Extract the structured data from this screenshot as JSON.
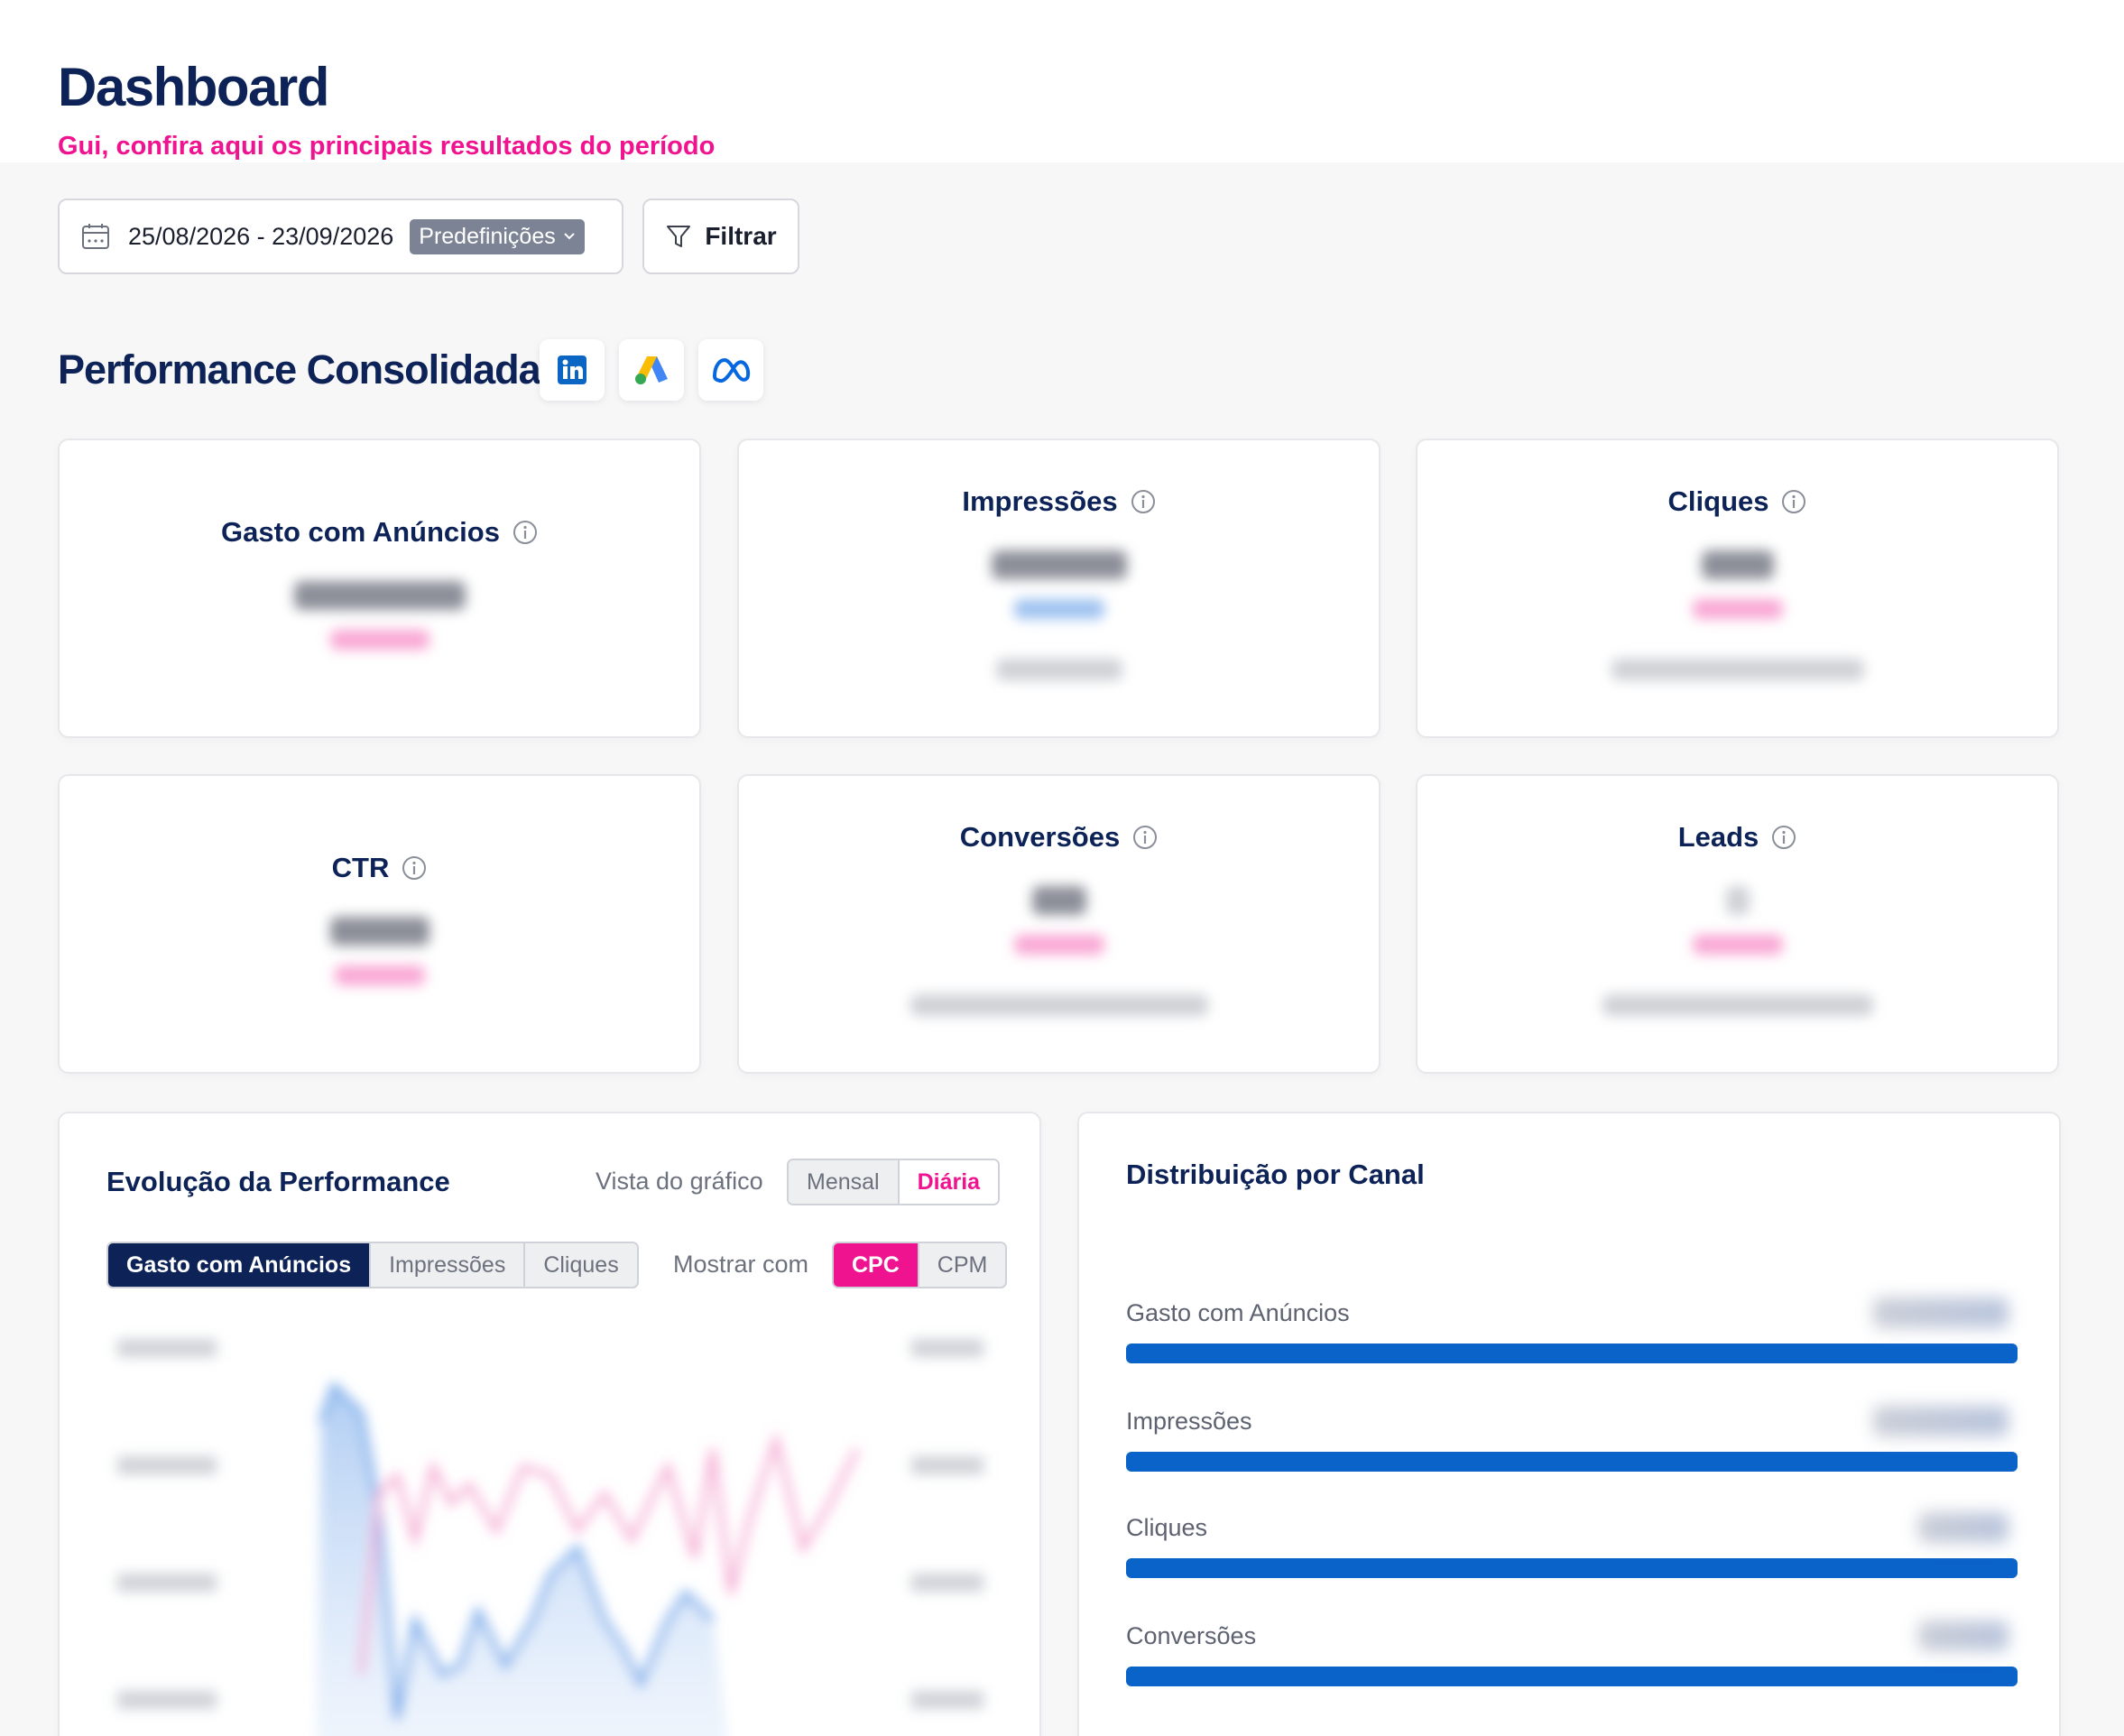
{
  "header": {
    "title": "Dashboard",
    "subtitle": "Gui, confira aqui os principais resultados do período"
  },
  "toolbar": {
    "date_range": "25/08/2026 - 23/09/2026",
    "preset_label": "Predefinições",
    "filter_label": "Filtrar"
  },
  "section": {
    "title": "Performance Consolidada",
    "platforms": [
      "linkedin-icon",
      "google-ads-icon",
      "meta-icon"
    ]
  },
  "metrics": [
    {
      "label": "Gasto com Anúncios"
    },
    {
      "label": "Impressões"
    },
    {
      "label": "Cliques"
    },
    {
      "label": "CTR"
    },
    {
      "label": "Conversões"
    },
    {
      "label": "Leads"
    }
  ],
  "chart": {
    "title": "Evolução da Performance",
    "view_label": "Vista do gráfico",
    "view_options": [
      "Mensal",
      "Diária"
    ],
    "view_selected": "Diária",
    "metric_tabs": [
      "Gasto com Anúncios",
      "Impressões",
      "Cliques"
    ],
    "metric_selected": "Gasto com Anúncios",
    "show_label": "Mostrar com",
    "show_options": [
      "CPC",
      "CPM"
    ],
    "show_selected": "CPC"
  },
  "distribution": {
    "title": "Distribuição por Canal",
    "rows": [
      {
        "label": "Gasto com Anúncios"
      },
      {
        "label": "Impressões"
      },
      {
        "label": "Cliques"
      },
      {
        "label": "Conversões"
      }
    ]
  },
  "colors": {
    "navy": "#0d2357",
    "pink": "#f0138f",
    "blue": "#0a63c9"
  }
}
